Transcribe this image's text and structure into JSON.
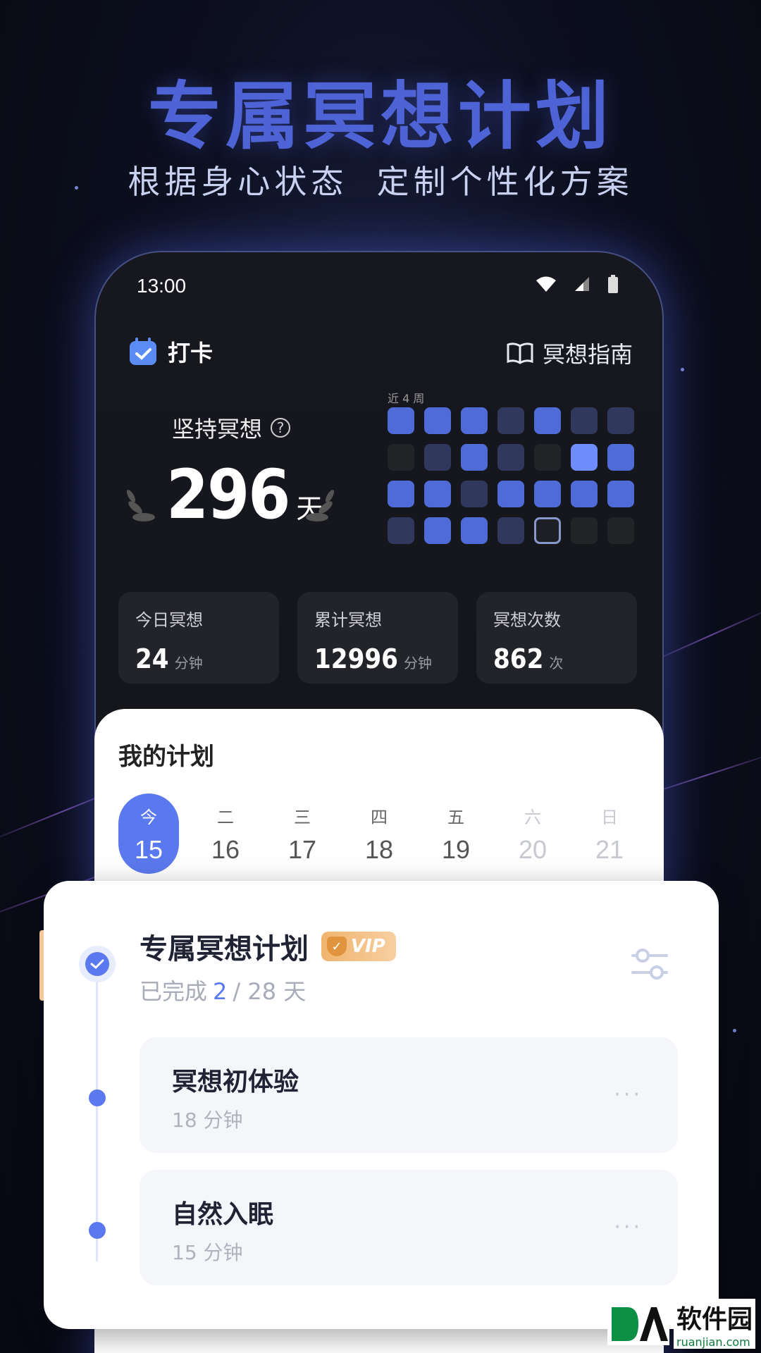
{
  "hero": {
    "title": "专属冥想计划",
    "subtitle": "根据身心状态  定制个性化方案"
  },
  "status_bar": {
    "time": "13:00"
  },
  "header": {
    "checkin_label": "打卡",
    "guide_label": "冥想指南"
  },
  "streak": {
    "label": "坚持冥想",
    "value": "296",
    "unit": "天",
    "weeks_label": "近 4 周"
  },
  "activity_grid": [
    [
      2,
      2,
      2,
      1,
      2,
      1,
      1
    ],
    [
      0,
      1,
      2,
      1,
      0,
      4,
      2
    ],
    [
      2,
      2,
      1,
      2,
      2,
      2,
      2
    ],
    [
      1,
      2,
      2,
      1,
      "today",
      0,
      0
    ]
  ],
  "stats": [
    {
      "label": "今日冥想",
      "value": "24",
      "unit": "分钟"
    },
    {
      "label": "累计冥想",
      "value": "12996",
      "unit": "分钟"
    },
    {
      "label": "冥想次数",
      "value": "862",
      "unit": "次"
    }
  ],
  "plan": {
    "title": "我的计划",
    "days": [
      {
        "weekday": "今",
        "date": "15",
        "state": "active"
      },
      {
        "weekday": "二",
        "date": "16",
        "state": "normal"
      },
      {
        "weekday": "三",
        "date": "17",
        "state": "normal"
      },
      {
        "weekday": "四",
        "date": "18",
        "state": "normal"
      },
      {
        "weekday": "五",
        "date": "19",
        "state": "normal"
      },
      {
        "weekday": "六",
        "date": "20",
        "state": "muted"
      },
      {
        "weekday": "日",
        "date": "21",
        "state": "muted"
      }
    ]
  },
  "card": {
    "title": "专属冥想计划",
    "vip_label": "VIP",
    "progress_prefix": "已完成",
    "progress_done": "2",
    "progress_total": "/ 28 天",
    "sessions": [
      {
        "name": "冥想初体验",
        "duration": "18 分钟",
        "more": "···"
      },
      {
        "name": "自然入眠",
        "duration": "15 分钟",
        "more": "···"
      }
    ]
  },
  "watermark": {
    "main": "软件园",
    "sub": "ruanjian.com"
  },
  "colors": {
    "accent": "#5b79ee",
    "hero_title": "#4d63d6",
    "vip": "#f0b46e"
  }
}
